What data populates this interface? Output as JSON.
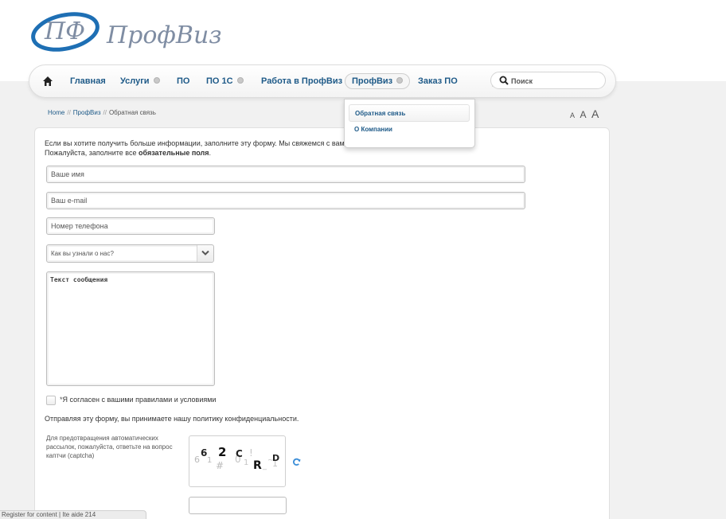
{
  "logo": {
    "monogram": "ПФ",
    "wordmark": "ПрофВиз",
    "color": "#1e6fb4"
  },
  "nav": {
    "home_icon": "home-icon",
    "items": [
      {
        "label": "Главная",
        "has_dropdown": false
      },
      {
        "label": "Услуги",
        "has_dropdown": true
      },
      {
        "label": "ПО",
        "has_dropdown": false
      },
      {
        "label": "ПО 1С",
        "has_dropdown": true
      },
      {
        "label": "Работа в ПрофВиз",
        "has_dropdown": false
      },
      {
        "label": "ПрофВиз",
        "has_dropdown": true,
        "active": true
      },
      {
        "label": "Заказ ПО",
        "has_dropdown": false
      }
    ],
    "dropdown_items": [
      "Обратная связь",
      "О Компании"
    ],
    "link_color": "#1e5a88"
  },
  "search": {
    "placeholder": "Поиск",
    "icon": "search-icon"
  },
  "breadcrumb": {
    "items": [
      "Home",
      "ПрофВиз",
      "Обратная связь"
    ],
    "separator": "//"
  },
  "font_sizer": [
    "A",
    "A",
    "A"
  ],
  "form": {
    "intro_line1": "Если вы хотите получить больше информации, заполните эту форму. Мы свяжемся с вам",
    "intro_line2_prefix": "Пожалуйста, заполните все",
    "intro_line2_bold": "обязательные поля",
    "intro_line2_suffix": ".",
    "name_placeholder": "Ваше имя",
    "email_placeholder": "Ваш e-mail",
    "phone_placeholder": "Номер телефона",
    "source_select": "Как вы узнали о нас?",
    "message_placeholder": "Текст сообщения",
    "agree_required_mark": "*",
    "agree_label": "Я согласен с вашими правилами и условиями",
    "privacy_note": "Отправляя эту форму, вы принимаете нашу политику конфиденциальности.",
    "captcha_label": "Для предотвращения автоматических рассылок, пожалуйста, ответьте на вопрос каптчи (captcha)",
    "captcha_chars": [
      "6",
      "2",
      "C",
      "R",
      "D"
    ],
    "captcha_noise": [
      "6",
      "1",
      "#",
      "0",
      "1",
      "!",
      "_",
      "1",
      "~"
    ],
    "refresh_icon": "refresh-icon"
  },
  "statusbar": {
    "text": "Register for content | Ite  aide 214"
  }
}
